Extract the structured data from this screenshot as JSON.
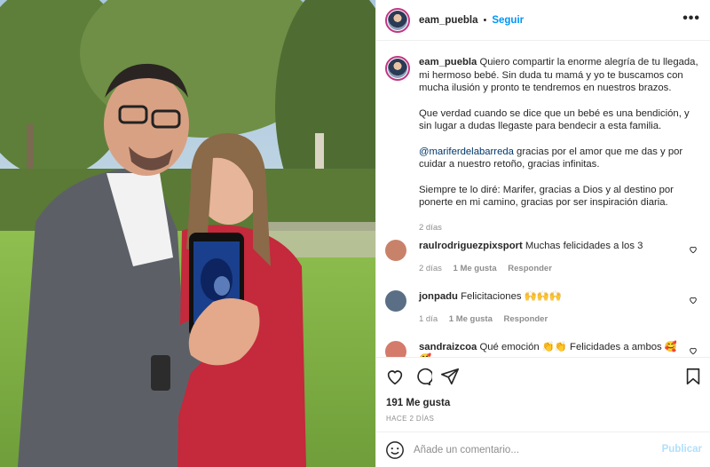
{
  "post": {
    "username": "eam_puebla",
    "separator": "•",
    "follow_label": "Seguir",
    "more_label": "•••"
  },
  "caption": {
    "username": "eam_puebla",
    "p1": "Quiero compartir la enorme alegría de tu llegada, mi hermoso bebé. Sin duda tu mamá y yo te buscamos con mucha ilusión y pronto te tendremos en nuestros brazos.",
    "p2": "Que verdad cuando se dice que un bebé es una bendición, y sin lugar a dudas llegaste para bendecir a esta familia.",
    "p3_mention": "@mariferdelabarreda",
    "p3_rest": " gracias por el amor que me das y por cuidar a nuestro retoño, gracias infinitas.",
    "p4": "Siempre te lo diré: Marifer, gracias a Dios y al destino por ponerte en mi camino, gracias por ser inspiración diaria.",
    "time": "2 días"
  },
  "comments": [
    {
      "user": "raulrodriguezpixsport",
      "text": "Muchas felicidades a los 3",
      "time": "2 días",
      "likes": "1 Me gusta",
      "reply": "Responder",
      "avatar_color": "#c9826a"
    },
    {
      "user": "jonpadu",
      "text": "Felicitaciones 🙌🙌🙌",
      "time": "1 día",
      "likes": "1 Me gusta",
      "reply": "Responder",
      "avatar_color": "#5a6f86"
    },
    {
      "user": "sandraizcoa",
      "text": "Qué emoción 👏👏 Felicidades a ambos 🥰🥰",
      "time": "",
      "likes": "",
      "reply": "",
      "avatar_color": "#d47b6b"
    }
  ],
  "actions": {
    "likes": "191 Me gusta",
    "ago": "HACE 2 DÍAS"
  },
  "add_comment": {
    "placeholder": "Añade un comentario...",
    "post_label": "Publicar"
  },
  "colors": {
    "accent": "#0095f6",
    "mention": "#00376b",
    "muted": "#8e8e8e",
    "publish_disabled": "#b2dffc"
  }
}
